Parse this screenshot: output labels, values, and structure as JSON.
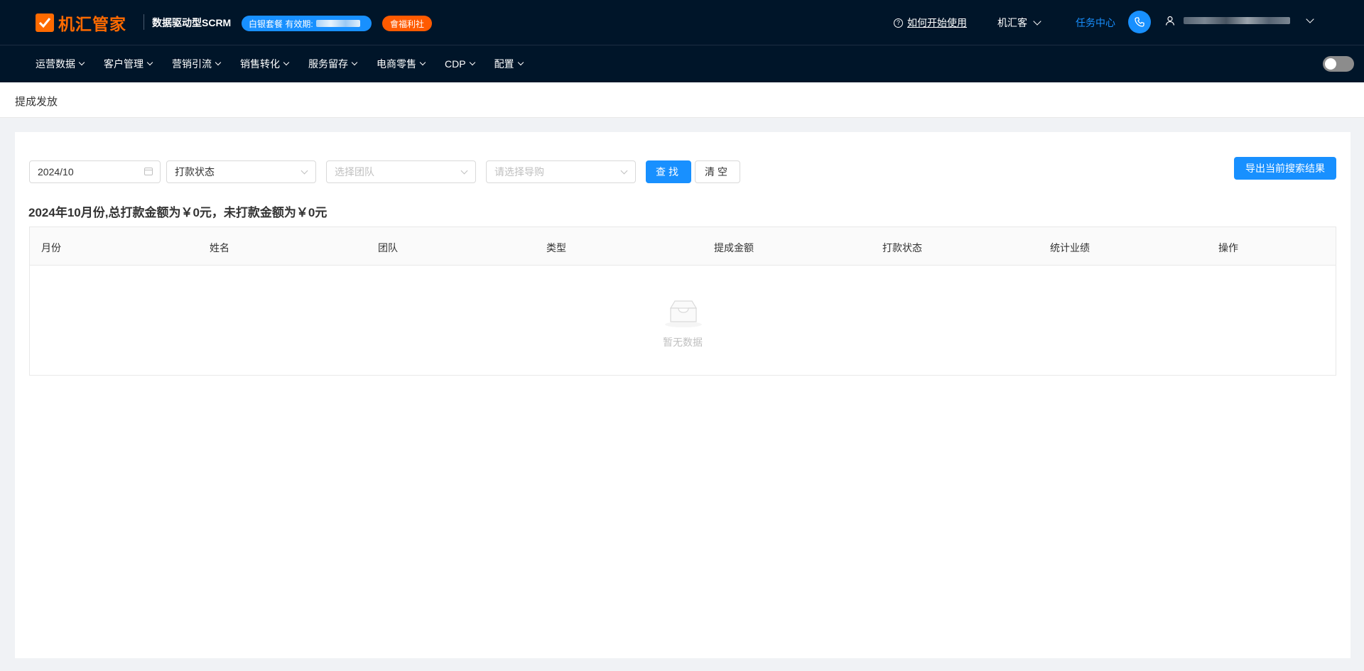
{
  "header": {
    "brand": "机汇管家",
    "slogan": "数据驱动型SCRM",
    "plan_badge": "白银套餐 有效期:",
    "welfare_badge": "會福利社",
    "help_link": "如何开始使用",
    "org_name": "机汇客",
    "task_center": "任务中心"
  },
  "nav": {
    "items": [
      "运营数据",
      "客户管理",
      "营销引流",
      "销售转化",
      "服务留存",
      "电商零售",
      "CDP",
      "配置"
    ]
  },
  "page": {
    "title": "提成发放"
  },
  "filters": {
    "month": "2024/10",
    "payment_status_placeholder": "打款状态",
    "team_placeholder": "选择团队",
    "guide_placeholder": "请选择导购",
    "search_label": "查找",
    "clear_label": "清空",
    "export_label": "导出当前搜索结果"
  },
  "summary": "2024年10月份,总打款金额为￥0元，未打款金额为￥0元",
  "table": {
    "columns": [
      "月份",
      "姓名",
      "团队",
      "类型",
      "提成金额",
      "打款状态",
      "统计业绩",
      "操作"
    ],
    "rows": [],
    "empty_text": "暂无数据"
  },
  "colors": {
    "header_bg": "#001529",
    "primary": "#1890ff",
    "brand": "#ff6a00",
    "welfare": "#ff5a00"
  }
}
